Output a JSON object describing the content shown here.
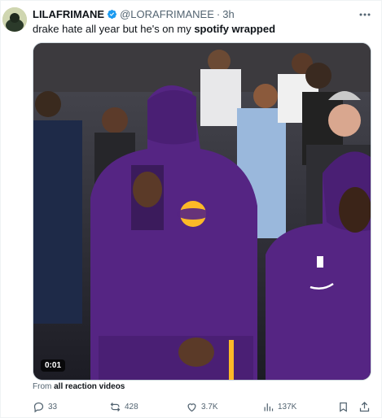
{
  "tweet": {
    "display_name": "LILAFRIMANE",
    "handle": "@LORAFRIMANEE",
    "separator": "·",
    "time": "3h",
    "text_prefix": "drake hate all year but he's on my ",
    "text_bold": "spotify wrapped",
    "video_timestamp": "0:01",
    "from_prefix": "From ",
    "from_source": "all reaction videos"
  },
  "stats": {
    "replies": "33",
    "reposts": "428",
    "likes": "3.7K",
    "views": "137K"
  },
  "colors": {
    "verified": "#1d9bf0",
    "jersey_purple": "#552583",
    "lakers_gold": "#fdb927",
    "muted_text": "#536471"
  },
  "icons": [
    "verified-badge-icon",
    "more-icon",
    "reply-icon",
    "repost-icon",
    "like-icon",
    "views-icon",
    "bookmark-icon",
    "share-icon"
  ]
}
